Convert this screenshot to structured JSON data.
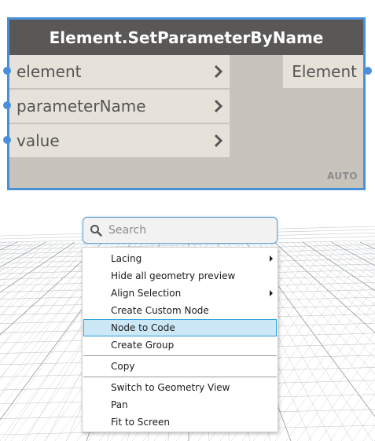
{
  "node": {
    "title": "Element.SetParameterByName",
    "inputs": [
      {
        "label": "element"
      },
      {
        "label": "parameterName"
      },
      {
        "label": "value"
      }
    ],
    "output": {
      "label": "Element"
    },
    "lacing_badge": "AUTO"
  },
  "search": {
    "placeholder": "Search",
    "value": ""
  },
  "context_menu": {
    "groups": [
      [
        {
          "label": "Lacing",
          "submenu": true
        },
        {
          "label": "Hide all geometry preview",
          "submenu": false
        },
        {
          "label": "Align Selection",
          "submenu": true
        },
        {
          "label": "Create Custom Node",
          "submenu": false
        },
        {
          "label": "Node to Code",
          "submenu": false,
          "highlighted": true
        },
        {
          "label": "Create Group",
          "submenu": false
        }
      ],
      [
        {
          "label": "Copy",
          "submenu": false
        }
      ],
      [
        {
          "label": "Switch to Geometry View",
          "submenu": false
        },
        {
          "label": "Pan",
          "submenu": false
        },
        {
          "label": "Fit to Screen",
          "submenu": false
        }
      ]
    ]
  },
  "colors": {
    "selection_border": "#4a90d9",
    "node_header": "#5a5856",
    "node_body": "#c8c4bc",
    "port_background": "#e6e2da",
    "menu_highlight": "#cce8f6",
    "menu_highlight_border": "#26a0da",
    "grid_line": "#c4c8cc",
    "grid_major_line": "#9aa0a6"
  }
}
